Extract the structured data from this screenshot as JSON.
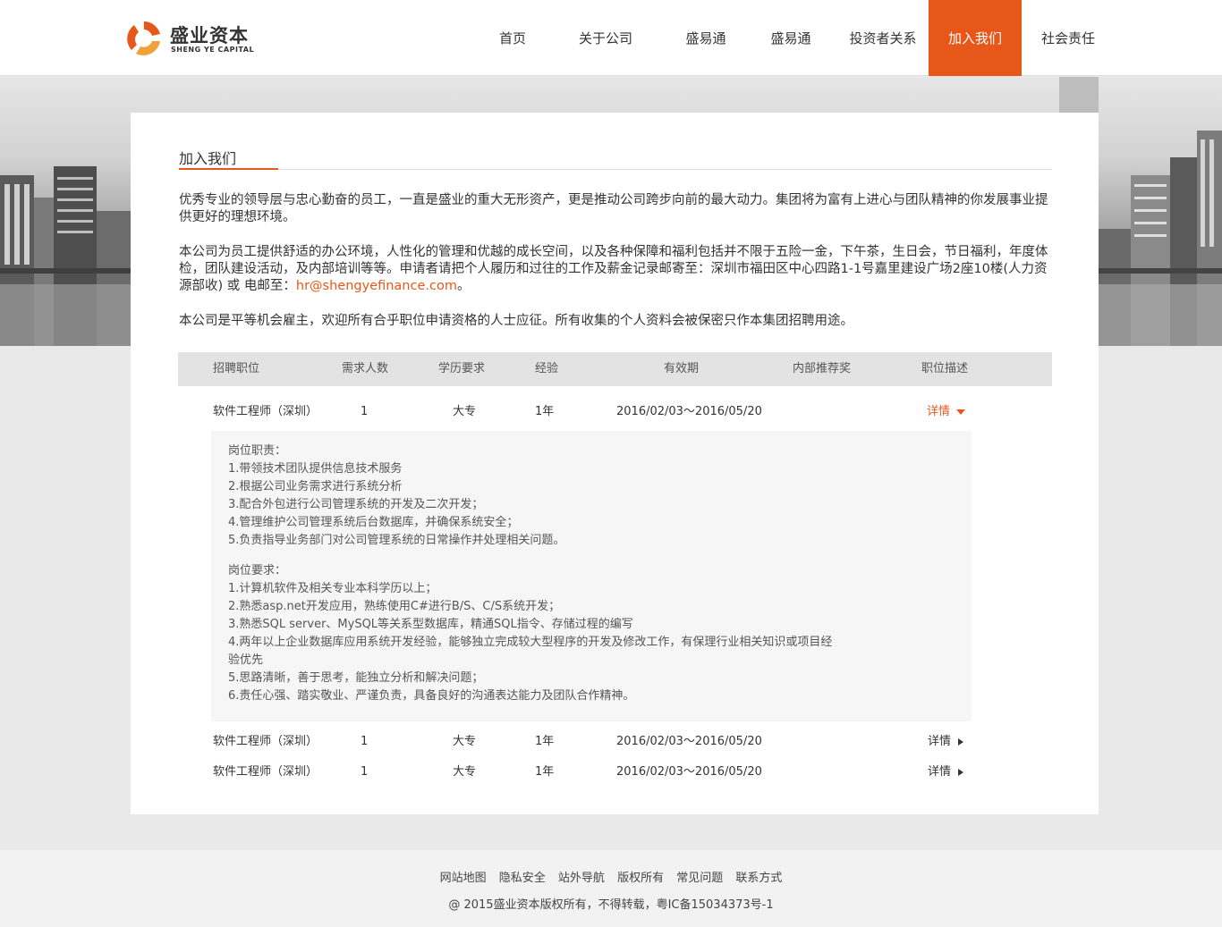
{
  "brand": {
    "name_cn": "盛业资本",
    "name_en": "SHENG YE CAPITAL",
    "accent": "#e8571a"
  },
  "nav": [
    "首页",
    "关于公司",
    "盛易通",
    "盛易通",
    "投资者关系",
    "加入我们",
    "社会责任"
  ],
  "nav_active": "加入我们",
  "section_title": "加入我们",
  "intro": {
    "p1": "优秀专业的领导层与忠心勤奋的员工，一直是盛业的重大无形资产，更是推动公司跨步向前的最大动力。集团将为富有上进心与团队精神的你发展事业提供更好的理想环境。",
    "p2": "本公司为员工提供舒适的办公环境，人性化的管理和优越的成长空间，以及各种保障和福利包括并不限于五险一金，下午茶，生日会，节日福利，年度体检，团队建设活动，及内部培训等等。申请者请把个人履历和过往的工作及薪金记录邮寄至：深圳市福田区中心四路1-1号嘉里建设广场2座10楼(人力资源部收) 或 电邮至：",
    "email": "hr@shengyefinance.com",
    "p2_end": "。",
    "p3": "本公司是平等机会雇主，欢迎所有合乎职位申请资格的人士应征。所有收集的个人资料会被保密只作本集团招聘用途。"
  },
  "table": {
    "headers": [
      "招聘职位",
      "需求人数",
      "学历要求",
      "经验",
      "有效期",
      "内部推荐奖",
      "职位描述"
    ],
    "rows": [
      {
        "position": "软件工程师（深圳）",
        "count": "1",
        "education": "大专",
        "experience": "1年",
        "validity": "2016/02/03～2016/05/20",
        "detail": "详情"
      },
      {
        "position": "软件工程师（深圳）",
        "count": "1",
        "education": "大专",
        "experience": "1年",
        "validity": "2016/02/03～2016/05/20",
        "detail": "详情"
      },
      {
        "position": "软件工程师（深圳）",
        "count": "1",
        "education": "大专",
        "experience": "1年",
        "validity": "2016/02/03～2016/05/20",
        "detail": "详情"
      }
    ]
  },
  "job_description": {
    "duties_title": "岗位职责：",
    "duties": [
      "1.带领技术团队提供信息技术服务",
      "2.根据公司业务需求进行系统分析",
      "3.配合外包进行公司管理系统的开发及二次开发；",
      "4.管理维护公司管理系统后台数据库，并确保系统安全；",
      "5.负责指导业务部门对公司管理系统的日常操作并处理相关问题。"
    ],
    "requirements_title": "岗位要求：",
    "requirements": [
      "1.计算机软件及相关专业本科学历以上；",
      "2.熟悉asp.net开发应用，熟练使用C#进行B/S、C/S系统开发；",
      "3.熟悉SQL server、MySQL等关系型数据库，精通SQL指令、存储过程的编写",
      "4.两年以上企业数据库应用系统开发经验，能够独立完成较大型程序的开发及修改工作，有保理行业相关知识或项目经",
      "验优先",
      "5.思路清晰，善于思考，能独立分析和解决问题；",
      "6.责任心强、踏实敬业、严谨负责，具备良好的沟通表达能力及团队合作精神。"
    ]
  },
  "footer": {
    "links": [
      "网站地图",
      "隐私安全",
      "站外导航",
      "版权所有",
      "常见问题",
      "联系方式"
    ],
    "copyright": "@ 2015盛业资本版权所有，不得转载，粤IC备15034373号-1"
  }
}
